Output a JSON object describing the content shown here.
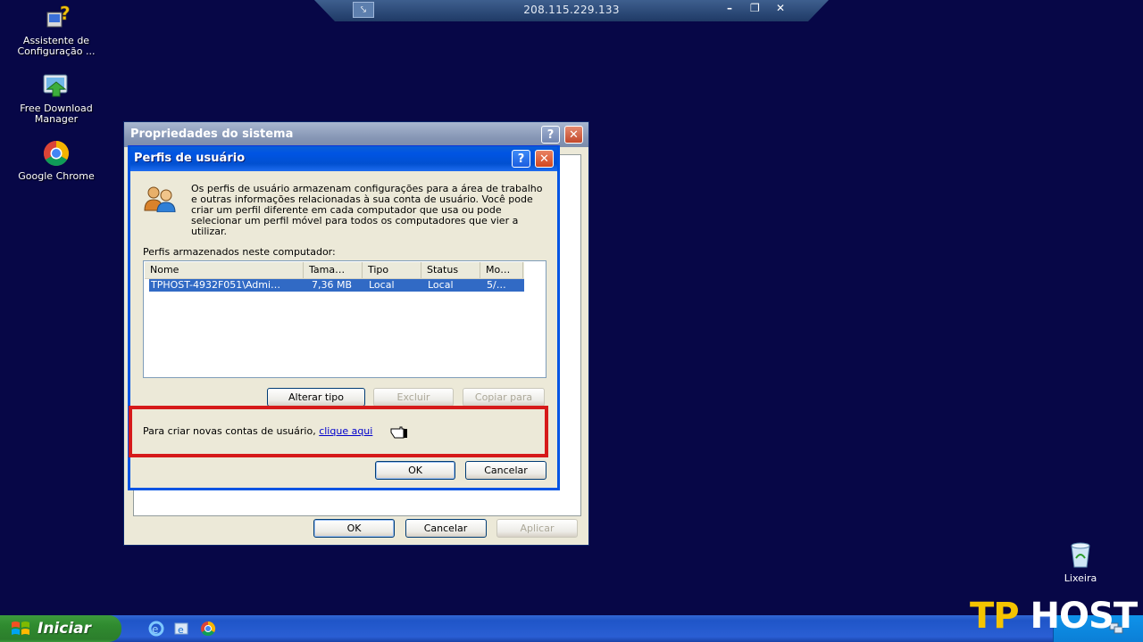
{
  "rdp_bar": {
    "title": "208.115.229.133",
    "pin_symbol": "⤥",
    "min_symbol": "–",
    "restore_symbol": "❐",
    "close_symbol": "✕"
  },
  "desktop_icons": [
    {
      "label": "Assistente de Configuração ...",
      "icon": "setup-wizard-icon"
    },
    {
      "label": "Free Download Manager",
      "icon": "download-manager-icon"
    },
    {
      "label": "Google Chrome",
      "icon": "chrome-icon"
    }
  ],
  "recycle_bin": {
    "label": "Lixeira",
    "icon": "recycle-bin-icon"
  },
  "outer_dialog": {
    "title": "Propriedades do sistema",
    "help_symbol": "?",
    "close_symbol": "✕",
    "buttons": {
      "ok": "OK",
      "cancel": "Cancelar",
      "apply": "Aplicar"
    }
  },
  "inner_dialog": {
    "title": "Perfis de usuário",
    "help_symbol": "?",
    "close_symbol": "✕",
    "intro_text": "Os perfis de usuário armazenam configurações para a área de trabalho e outras informações relacionadas à sua conta de usuário. Você pode criar um perfil diferente em cada computador que usa ou pode selecionar um perfil móvel para todos os computadores que vier a utilizar.",
    "stored_label": "Perfis armazenados neste computador:",
    "columns": [
      "Nome",
      "Tama…",
      "Tipo",
      "Status",
      "Mo…"
    ],
    "rows": [
      {
        "name": "TPHOST-4932F051\\Admi…",
        "size": "7,36 MB",
        "type": "Local",
        "status": "Local",
        "modified": "5/…"
      }
    ],
    "profile_buttons": {
      "change_type": "Alterar tipo",
      "delete": "Excluir",
      "copy_to": "Copiar para"
    },
    "create_text": "Para criar novas contas de usuário,",
    "create_link": "clique aqui",
    "buttons": {
      "ok": "OK",
      "cancel": "Cancelar"
    }
  },
  "taskbar": {
    "start_label": "Iniciar"
  },
  "brand": {
    "tp": "TP",
    "host": "HOST"
  }
}
